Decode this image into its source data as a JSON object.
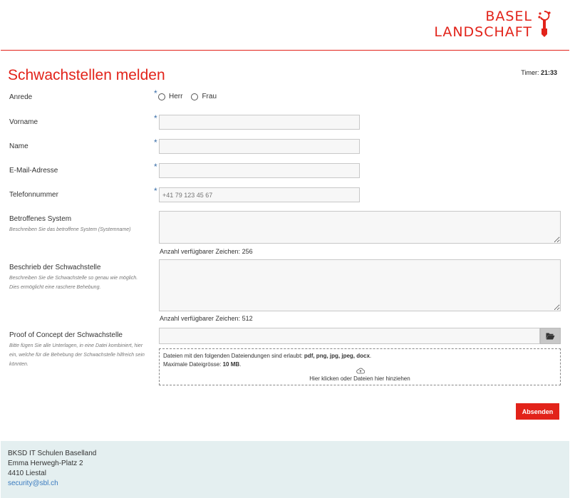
{
  "header": {
    "logo_line1": "BASEL",
    "logo_line2": "LANDSCHAFT",
    "logo_mark_icon": "basel-crozier-icon",
    "brand_color": "#e2231a"
  },
  "page": {
    "title": "Schwachstellen melden",
    "timer_label": "Timer:",
    "timer_value": "21:33"
  },
  "form": {
    "required_marker": "*",
    "salutation": {
      "label": "Anrede",
      "options": [
        "Herr",
        "Frau"
      ],
      "selected": null
    },
    "first_name": {
      "label": "Vorname",
      "value": "",
      "placeholder": ""
    },
    "last_name": {
      "label": "Name",
      "value": "",
      "placeholder": ""
    },
    "email": {
      "label": "E-Mail-Adresse",
      "value": "",
      "placeholder": ""
    },
    "phone": {
      "label": "Telefonnummer",
      "value": "",
      "placeholder": "+41 79 123 45 67"
    },
    "affected_system": {
      "label": "Betroffenes System",
      "hint": "Beschreiben Sie das betroffene System (Systemname)",
      "counter": "Anzahl verfügbarer Zeichen: 256"
    },
    "description": {
      "label": "Beschrieb der Schwachstelle",
      "hint": "Beschreiben Sie die Schwachstelle so genau wie möglich. Dies ermöglicht eine raschere Behebung.",
      "counter": "Anzahl verfügbarer Zeichen: 512"
    },
    "poc": {
      "label": "Proof of Concept der Schwachstelle",
      "hint": "Bitte fügen Sie alle Unterlagen, in eine Datei kombiniert, hier ein, welche für die Behebung der Schwachstelle hilfreich sein könnten.",
      "browse_icon": "folder-open-icon",
      "dropzone": {
        "allowed_prefix": "Dateien mit den folgenden Dateiendungen sind erlaubt: ",
        "allowed_ext": "pdf, png, jpg, jpeg, docx",
        "allowed_suffix": ".",
        "maxsize_prefix": "Maximale Dateigrösse: ",
        "maxsize_value": "10 MB",
        "maxsize_suffix": ".",
        "upload_icon": "cloud-upload-icon",
        "cta": "Hier klicken oder Dateien hier hinziehen"
      }
    },
    "submit_label": "Absenden"
  },
  "footer": {
    "org": "BKSD IT Schulen Baselland",
    "street": "Emma Herwegh-Platz 2",
    "city": "4410 Liestal",
    "email": "security@sbl.ch",
    "background": "#e4eff0"
  }
}
